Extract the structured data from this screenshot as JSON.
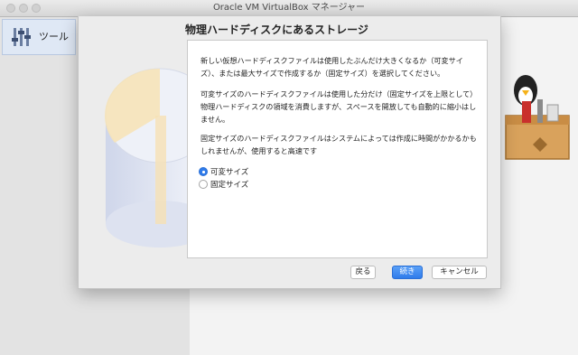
{
  "window": {
    "title": "Oracle VM VirtualBox マネージャー"
  },
  "sidebar": {
    "tools_label": "ツール"
  },
  "dialog": {
    "title": "物理ハードディスクにあるストレージ",
    "paragraphs": [
      "新しい仮想ハードディスクファイルは使用したぶんだけ大きくなるか（可変サイズ）、または最大サイズで作成するか（固定サイズ）を選択してください。",
      "可変サイズのハードディスクファイルは使用した分だけ（固定サイズを上限として）物理ハードディスクの領域を消費しますが、スペースを開放しても自動的に縮小はしません。",
      "固定サイズのハードディスクファイルはシステムによっては作成に時間がかかるかもしれませんが、使用すると高速です"
    ],
    "options": [
      {
        "label": "可変サイズ",
        "selected": true
      },
      {
        "label": "固定サイズ",
        "selected": false
      }
    ],
    "buttons": {
      "back": "戻る",
      "next": "続き",
      "cancel": "キャンセル"
    },
    "accent_color": "#2f7bea"
  }
}
